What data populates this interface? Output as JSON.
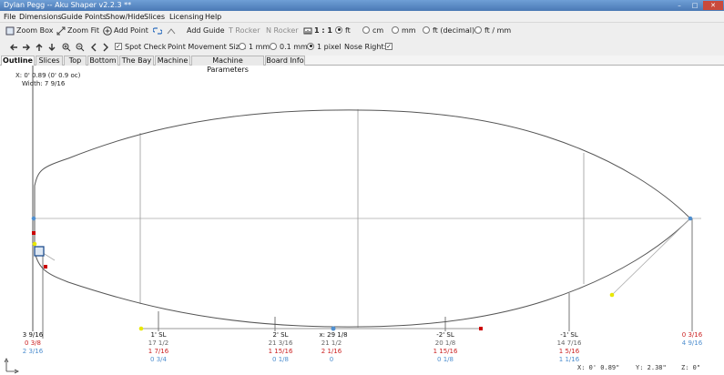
{
  "window": {
    "title": "Dylan Pegg -- Aku Shaper v2.2.3 **",
    "controls": [
      "–",
      "□",
      "✕"
    ]
  },
  "menu": [
    "File",
    "Dimensions",
    "Guide Points",
    "Show/Hide",
    "Slices",
    "Licensing",
    "Help"
  ],
  "toolbar1": {
    "zoom_box": "Zoom Box",
    "zoom_fit": "Zoom Fit",
    "add_point": "Add Point",
    "add_guide": "Add Guide",
    "t_rocker": "T Rocker",
    "n_rocker": "N Rocker",
    "scale": "1 : 1",
    "units": [
      "ft",
      "cm",
      "mm",
      "ft (decimal)",
      "ft / mm"
    ],
    "selected_unit": "ft"
  },
  "toolbar2": {
    "spot_check": "Spot Check",
    "movement_label": "Point Movement Size:",
    "movement_options": [
      "1 mm",
      "0.1 mm",
      "1 pixel"
    ],
    "selected_movement": "1 pixel",
    "nose_right_label": "Nose Right:",
    "nose_right_checked": true
  },
  "tabs": [
    "Outline",
    "Slices",
    "Top",
    "Bottom",
    "The Bay",
    "Machine",
    "Machine Parameters",
    "Board Info"
  ],
  "active_tab": "Outline",
  "cursor_info": {
    "coords": "X: 0' 0.89 (0' 0.9 oc)",
    "width": "Width: 7 9/16"
  },
  "station_labels": [
    {
      "key": "tail",
      "title": "3 9/16",
      "red": "0 3/8",
      "blue": "2 3/16"
    },
    {
      "key": "1sl",
      "title": "1' SL",
      "gray": "17 1/2",
      "red": "1 7/16",
      "blue": "0 3/4"
    },
    {
      "key": "2sl",
      "title": "2' SL",
      "gray": "21 3/16",
      "red": "1 15/16",
      "blue": "0 1/8"
    },
    {
      "key": "mid",
      "title": "x: 29 1/8",
      "gray": "21 1/2",
      "red": "2 1/16",
      "blue": "0"
    },
    {
      "key": "m2sl",
      "title": "-2' SL",
      "gray": "20 1/8",
      "red": "1 15/16",
      "blue": "0 1/8"
    },
    {
      "key": "m1sl",
      "title": "-1' SL",
      "gray": "14 7/16",
      "red": "1 5/16",
      "blue": "1 1/16"
    },
    {
      "key": "nose",
      "red_top": "0 3/16",
      "blue": "4 9/16"
    }
  ],
  "status_bar": {
    "x": "X:  0' 0.89\"",
    "y": "Y:  2.38\"",
    "z": "Z:      0\""
  },
  "colors": {
    "outline": "#555555",
    "guide": "#999999",
    "red_point": "#cc0000",
    "yellow_point": "#e8e800",
    "blue_point": "#4f8fcf"
  }
}
